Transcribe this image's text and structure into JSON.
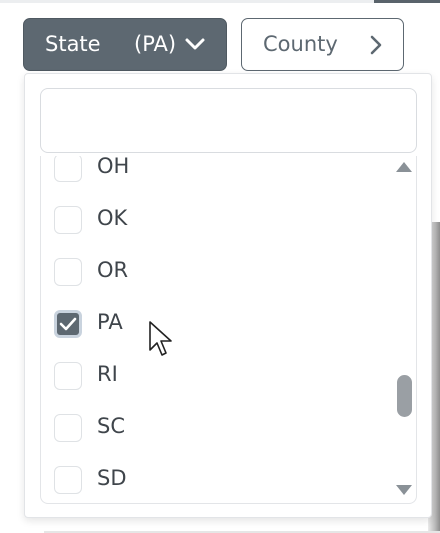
{
  "filters": {
    "state_button": {
      "label": "State",
      "value": "(PA)",
      "icon": "chevron-down-icon"
    },
    "county_button": {
      "label": "County",
      "icon": "chevron-right-icon"
    }
  },
  "dropdown": {
    "search": {
      "value": "",
      "placeholder": ""
    },
    "options": [
      {
        "label": "OH",
        "checked": false
      },
      {
        "label": "OK",
        "checked": false
      },
      {
        "label": "OR",
        "checked": false
      },
      {
        "label": "PA",
        "checked": true
      },
      {
        "label": "RI",
        "checked": false
      },
      {
        "label": "SC",
        "checked": false
      },
      {
        "label": "SD",
        "checked": false
      }
    ],
    "scrollbar": {
      "up_icon": "triangle-up-icon",
      "down_icon": "triangle-down-icon"
    }
  },
  "colors": {
    "accent": "#5d6871",
    "checkbox_focus_ring": "#c9d3de",
    "text": "#3f454b"
  }
}
